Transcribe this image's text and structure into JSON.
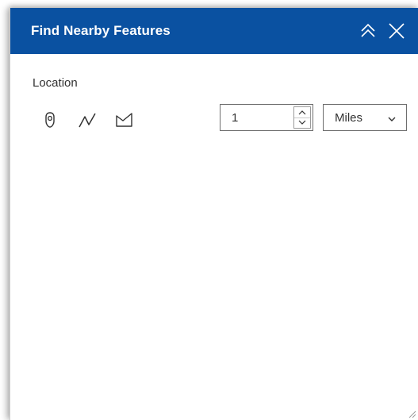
{
  "panel": {
    "title": "Find Nearby Features",
    "header_color": "#0a51a1",
    "header_icons": [
      "double-chevron-up-icon",
      "close-icon"
    ]
  },
  "location": {
    "label": "Location",
    "tools": [
      "map-pin-icon",
      "polyline-icon",
      "polygon-icon"
    ]
  },
  "distance": {
    "value": "1",
    "unit": "Miles"
  }
}
